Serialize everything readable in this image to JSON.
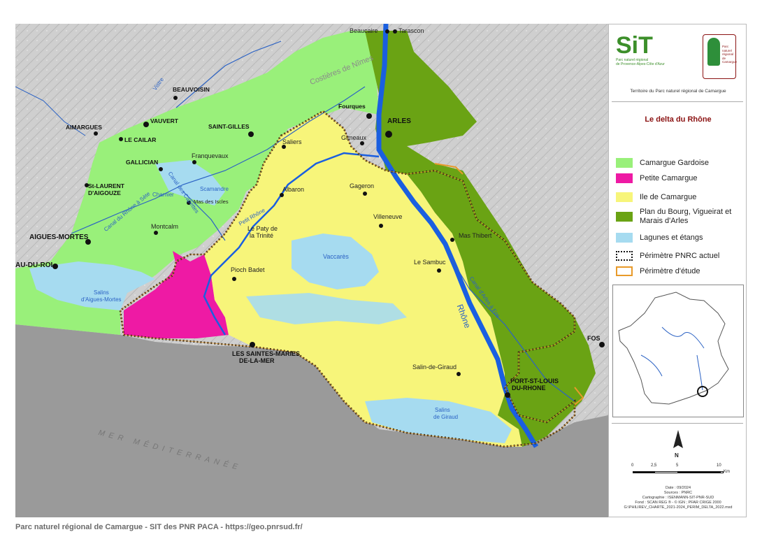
{
  "footer": "Parc naturel régional de Camargue - SIT des PNR PACA - https://geo.pnrsud.fr/",
  "header": {
    "sit_logo_text": "SiT",
    "sit_logo_sub1": "Parc naturel régional",
    "sit_logo_sub2": "de Provence-Alpes-Côte d'Azur",
    "parc_logo_text": "Parc naturel régional de Camargue",
    "territory": "Territoire du Parc naturel régional de Camargue"
  },
  "legend": {
    "title": "Le delta du Rhône",
    "items": [
      {
        "label": "Camargue Gardoise",
        "color": "#99f07a",
        "type": "fill"
      },
      {
        "label": "Petite Camargue",
        "color": "#ee1aa4",
        "type": "fill"
      },
      {
        "label": "Ile de Camargue",
        "color": "#f7f57a",
        "type": "fill"
      },
      {
        "label": "Plan du Bourg, Vigueirat et Marais d'Arles",
        "color": "#6aa314",
        "type": "fill"
      },
      {
        "label": "Lagunes et étangs",
        "color": "#a6dbf0",
        "type": "fill"
      },
      {
        "label": "Périmètre PNRC actuel",
        "color": "#111111",
        "type": "dotted"
      },
      {
        "label": "Périmètre d'étude",
        "color": "#e89a2a",
        "type": "outline"
      }
    ]
  },
  "scale": {
    "ticks": [
      "0",
      "2,5",
      "5",
      "10"
    ],
    "unit": "Km",
    "north": "N"
  },
  "meta": {
    "date": "Date : 09/2024",
    "sources": "Sources : PNRC",
    "cartography": "Cartographie : ISENMANN-SIT-PNR-SUD",
    "fond": "Fond : SCAN REG ® - © IGN ; PFAR CRIGE 2000",
    "path": "G:\\PHILIREV_CHARTE_2021-2024_PERIM_DELTA_2022.mxd"
  },
  "map": {
    "towns": [
      {
        "name": "Beaucaire",
        "cls": ""
      },
      {
        "name": "Tarascon",
        "cls": ""
      },
      {
        "name": "BEAUVOISIN",
        "cls": "bold"
      },
      {
        "name": "VAUVERT",
        "cls": "bold"
      },
      {
        "name": "AIMARGUES",
        "cls": "bold"
      },
      {
        "name": "LE CAILAR",
        "cls": "bold"
      },
      {
        "name": "SAINT-GILLES",
        "cls": "bold"
      },
      {
        "name": "Fourques",
        "cls": "bold"
      },
      {
        "name": "ARLES",
        "cls": "bold"
      },
      {
        "name": "Gimeaux",
        "cls": ""
      },
      {
        "name": "Saliers",
        "cls": ""
      },
      {
        "name": "Franquevaux",
        "cls": ""
      },
      {
        "name": "GALLICIAN",
        "cls": "bold"
      },
      {
        "name": "St-LAURENT",
        "cls": "bold"
      },
      {
        "name": "D'AIGOUZE",
        "cls": "bold"
      },
      {
        "name": "Mas des Iscles",
        "cls": ""
      },
      {
        "name": "Albaron",
        "cls": ""
      },
      {
        "name": "Gageron",
        "cls": ""
      },
      {
        "name": "Villeneuve",
        "cls": ""
      },
      {
        "name": "Montcalm",
        "cls": ""
      },
      {
        "name": "Le Paty de",
        "cls": ""
      },
      {
        "name": "la Trinité",
        "cls": ""
      },
      {
        "name": "AIGUES-MORTES",
        "cls": "bold"
      },
      {
        "name": "AU-DU-ROI",
        "cls": "bold"
      },
      {
        "name": "Pioch Badet",
        "cls": ""
      },
      {
        "name": "Mas Thibert",
        "cls": ""
      },
      {
        "name": "Le Sambuc",
        "cls": ""
      },
      {
        "name": "LES SAINTES-MARIES",
        "cls": "bold"
      },
      {
        "name": "DE-LA-MER",
        "cls": "bold"
      },
      {
        "name": "Salin-de-Giraud",
        "cls": ""
      },
      {
        "name": "PORT-ST-LOUIS",
        "cls": "bold"
      },
      {
        "name": "DU-RHONE",
        "cls": "bold"
      },
      {
        "name": "FOS",
        "cls": "bold"
      }
    ],
    "water": [
      "Vaccarès",
      "Scamandre",
      "Charnier",
      "Salins",
      "d'Aigues-Mortes",
      "Salins",
      "de Giraud",
      "Rhône",
      "Petit Rhône",
      "Canal du Rhône à Sète",
      "Canal des Capettes",
      "Canal d'Arles à Fos",
      "Vistre",
      "Costières de Nîmes"
    ],
    "sea": "MER MÉDITERRANÉE"
  }
}
